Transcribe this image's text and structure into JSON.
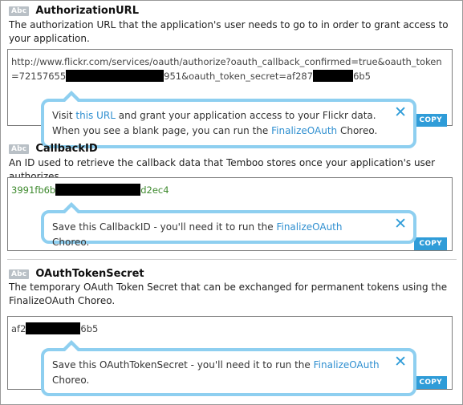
{
  "sections": [
    {
      "badge": "Abc",
      "title": "AuthorizationURL",
      "description": "The authorization URL that the application's user needs to go to in order to grant access to your application.",
      "value_parts": [
        "http://www.flickr.com/services/oauth/authorize?oauth_callback_confirmed=true&oauth_token=72157655",
        "951&oauth_token_secret=af287",
        "6b5"
      ],
      "tooltip": {
        "t1": "Visit ",
        "link1": "this URL",
        "t2": " and grant your application access to your Flickr data. When you see a blank page, you can run the ",
        "link2": "FinalizeOAuth",
        "t3": " Choreo."
      },
      "copy_label": "COPY"
    },
    {
      "badge": "Abc",
      "title": "CallbackID",
      "description": "An ID used to retrieve the callback data that Temboo stores once your application's user authorizes.",
      "value_parts": [
        "3991fb6b",
        "d2ec4"
      ],
      "tooltip": {
        "t1": "Save this CallbackID - you'll need it to run the ",
        "link1": "FinalizeOAuth",
        "t2": " Choreo."
      },
      "copy_label": "COPY"
    },
    {
      "badge": "Abc",
      "title": "OAuthTokenSecret",
      "description": "The temporary OAuth Token Secret that can be exchanged for permanent tokens using the FinalizeOAuth Choreo.",
      "value_parts": [
        "af2",
        "6b5"
      ],
      "tooltip": {
        "t1": "Save this OAuthTokenSecret - you'll need it to run the ",
        "link1": "FinalizeOAuth",
        "t2": " Choreo."
      },
      "copy_label": "COPY"
    }
  ],
  "icons": {
    "close": "✕"
  },
  "colors": {
    "accent": "#2f9cd8",
    "tooltip_border": "#8ecff0",
    "value_green": "#3e8a2e",
    "badge": "#b9c0c6"
  }
}
